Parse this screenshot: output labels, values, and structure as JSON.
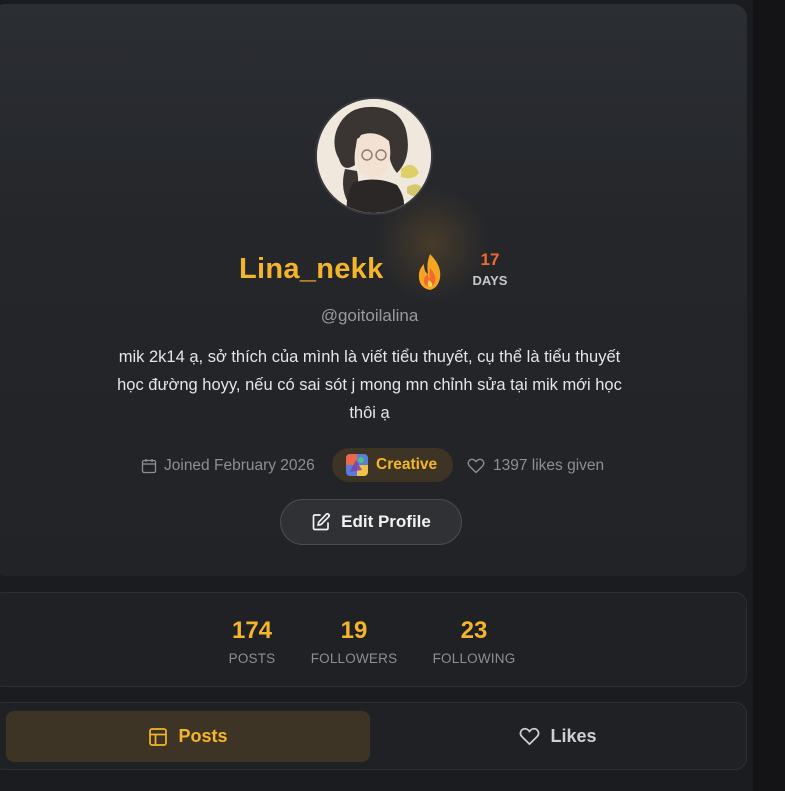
{
  "profile": {
    "display_name": "Lina_nekk",
    "handle": "@goitoilalina",
    "bio": "mik 2k14 ạ, sở thích của mình là viết tiểu thuyết, cụ thể là tiểu thuyết học đường hoyy, nếu có sai sót j mong mn chỉnh sửa tại mik mới học thôi ạ",
    "avatar_icon": "anime-girl-avatar"
  },
  "streak": {
    "count": "17",
    "unit": "DAYS",
    "icon": "flame-icon",
    "color": "#f26a2e"
  },
  "meta": {
    "joined": "Joined February 2026",
    "badge_label": "Creative",
    "likes_given": "1397 likes given"
  },
  "edit_button": {
    "label": "Edit Profile"
  },
  "stats": [
    {
      "value": "174",
      "label": "POSTS"
    },
    {
      "value": "19",
      "label": "FOLLOWERS"
    },
    {
      "value": "23",
      "label": "FOLLOWING"
    }
  ],
  "tabs": [
    {
      "label": "Posts",
      "active": true
    },
    {
      "label": "Likes",
      "active": false
    }
  ],
  "colors": {
    "accent": "#f5b52a",
    "background": "#1b1c1f",
    "card": "#24262a",
    "muted_text": "#8f8f8f"
  }
}
